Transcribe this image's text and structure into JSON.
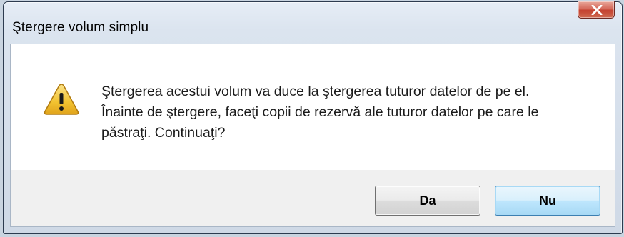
{
  "window": {
    "title": "Ştergere volum simplu",
    "close_icon": "close-icon"
  },
  "dialog": {
    "icon": "warning-icon",
    "message_lines": [
      "Ştergerea acestui volum va duce la ştergerea tuturor datelor de pe el.",
      "Înainte de ştergere, faceţi copii de rezervă ale tuturor datelor pe care le",
      "păstraţi. Continuaţi?"
    ]
  },
  "buttons": {
    "yes_label": "Da",
    "no_label": "Nu"
  },
  "colors": {
    "warning_fill": "#f2c230",
    "close_button": "#c4412f",
    "default_button_border": "#3c7fb1"
  }
}
